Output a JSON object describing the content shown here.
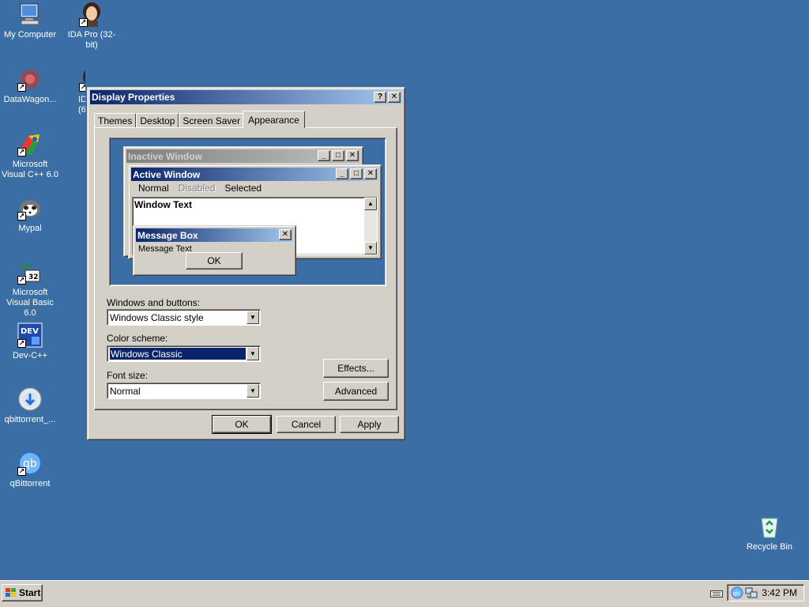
{
  "desktop": {
    "background": "#3a6ea5",
    "icons": [
      {
        "label": "My Computer",
        "icon": "computer-icon"
      },
      {
        "label": "IDA Pro (32-bit)",
        "icon": "ida-icon"
      },
      {
        "label": "DataWagon...",
        "icon": "datawagon-icon"
      },
      {
        "label": "ID (6",
        "icon": "ida-icon"
      },
      {
        "label": "Microsoft Visual C++ 6.0",
        "icon": "msvc-icon"
      },
      {
        "label": "Mypal",
        "icon": "mypal-icon"
      },
      {
        "label": "Microsoft Visual Basic 6.0",
        "icon": "vb-icon"
      },
      {
        "label": "Dev-C++",
        "icon": "devcpp-icon"
      },
      {
        "label": "qbittorrent_...",
        "icon": "installer-icon"
      },
      {
        "label": "qBittorrent",
        "icon": "qbittorrent-icon"
      },
      {
        "label": "Recycle Bin",
        "icon": "recycle-bin-icon"
      }
    ]
  },
  "dialog": {
    "title": "Display Properties",
    "help_btn": "?",
    "close_btn": "✕",
    "tabs": [
      {
        "label": "Themes"
      },
      {
        "label": "Desktop"
      },
      {
        "label": "Screen Saver"
      },
      {
        "label": "Appearance"
      }
    ],
    "active_tab": "Appearance",
    "preview": {
      "inactive_title": "Inactive Window",
      "active_title": "Active Window",
      "menu_normal": "Normal",
      "menu_disabled": "Disabled",
      "menu_selected": "Selected",
      "window_text": "Window Text",
      "msgbox_title": "Message Box",
      "msgbox_text": "Message Text",
      "msgbox_ok": "OK"
    },
    "windows_buttons_label": "Windows and buttons:",
    "windows_buttons_value": "Windows Classic style",
    "color_scheme_label": "Color scheme:",
    "color_scheme_value": "Windows Classic",
    "font_size_label": "Font size:",
    "font_size_value": "Normal",
    "effects_btn": "Effects...",
    "advanced_btn": "Advanced",
    "ok_btn": "OK",
    "cancel_btn": "Cancel",
    "apply_btn": "Apply"
  },
  "taskbar": {
    "start_label": "Start",
    "clock": "3:42 PM",
    "tray_qb": "qb"
  },
  "colors": {
    "active_title_start": "#0a246a",
    "active_title_end": "#a6caf0",
    "face": "#d4d0c8"
  }
}
